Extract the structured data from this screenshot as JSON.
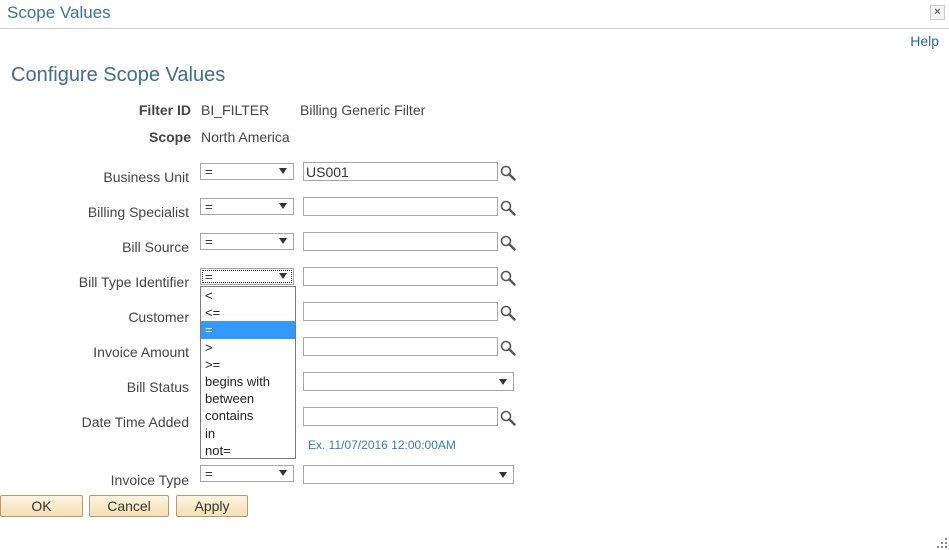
{
  "window": {
    "title": "Scope Values",
    "close_glyph": "×"
  },
  "help_link": "Help",
  "page_title": "Configure Scope Values",
  "filter": {
    "id_label": "Filter ID",
    "id_value": "BI_FILTER",
    "id_description": "Billing Generic Filter",
    "scope_label": "Scope",
    "scope_value": "North America"
  },
  "fields": [
    {
      "label": "Business Unit",
      "operator": "=",
      "value": "US001",
      "type": "text"
    },
    {
      "label": "Billing Specialist",
      "operator": "=",
      "value": "",
      "type": "text"
    },
    {
      "label": "Bill Source",
      "operator": "=",
      "value": "",
      "type": "text"
    },
    {
      "label": "Bill Type Identifier",
      "operator": "=",
      "value": "",
      "type": "text"
    },
    {
      "label": "Customer",
      "operator": "=",
      "value": "",
      "type": "text"
    },
    {
      "label": "Invoice Amount",
      "operator": "=",
      "value": "",
      "type": "text"
    },
    {
      "label": "Bill Status",
      "operator": "=",
      "value": "",
      "type": "select"
    },
    {
      "label": "Date Time Added",
      "operator": "=",
      "value": "",
      "type": "text",
      "hint": "Ex. 11/07/2016 12:00:00AM"
    },
    {
      "label": "Invoice Type",
      "operator": "=",
      "value": "",
      "type": "select"
    }
  ],
  "operator_dropdown": {
    "options": [
      "<",
      "<=",
      "=",
      ">",
      ">=",
      "begins with",
      "between",
      "contains",
      "in",
      "not="
    ],
    "selected": "="
  },
  "buttons": {
    "ok": "OK",
    "cancel": "Cancel",
    "apply": "Apply"
  },
  "colors": {
    "title": "#3b6fa0",
    "link": "#2a65a0",
    "selected": "#3399ff",
    "button_bg": "#f5dfb4"
  },
  "icons": {
    "lookup": "magnifier-icon",
    "close": "close-icon",
    "grip": "resize-grip-icon"
  }
}
